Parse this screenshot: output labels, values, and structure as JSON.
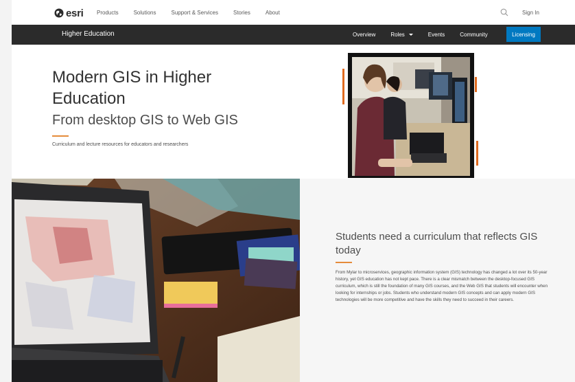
{
  "topnav": {
    "logo_text": "esri",
    "links": [
      "Products",
      "Solutions",
      "Support & Services",
      "Stories",
      "About"
    ],
    "search_icon": "search-icon",
    "signin_label": "Sign In"
  },
  "subnav": {
    "brand": "Higher Education",
    "items": [
      "Overview",
      "Roles",
      "Events",
      "Community"
    ],
    "cta_label": "Licensing",
    "cta_color": "#0079c1"
  },
  "hero": {
    "title": "Modern GIS in Higher Education",
    "subtitle": "From desktop GIS to Web GIS",
    "tagline": "Curriculum and lecture resources for educators and researchers",
    "accent_color": "#e58b3a"
  },
  "section": {
    "heading": "Students need a curriculum that reflects GIS today",
    "body": "From Mylar to microservices, geographic information system (GIS) technology has changed a lot over its 50-year history, yet GIS education has not kept pace. There is a clear mismatch between the desktop-focused GIS curriculum, which is still the foundation of many GIS courses, and the Web GIS that students will encounter when looking for internships or jobs. Students who understand modern GIS concepts and can apply modern GIS technologies will be more competitive and have the skills they need to succeed in their careers."
  }
}
